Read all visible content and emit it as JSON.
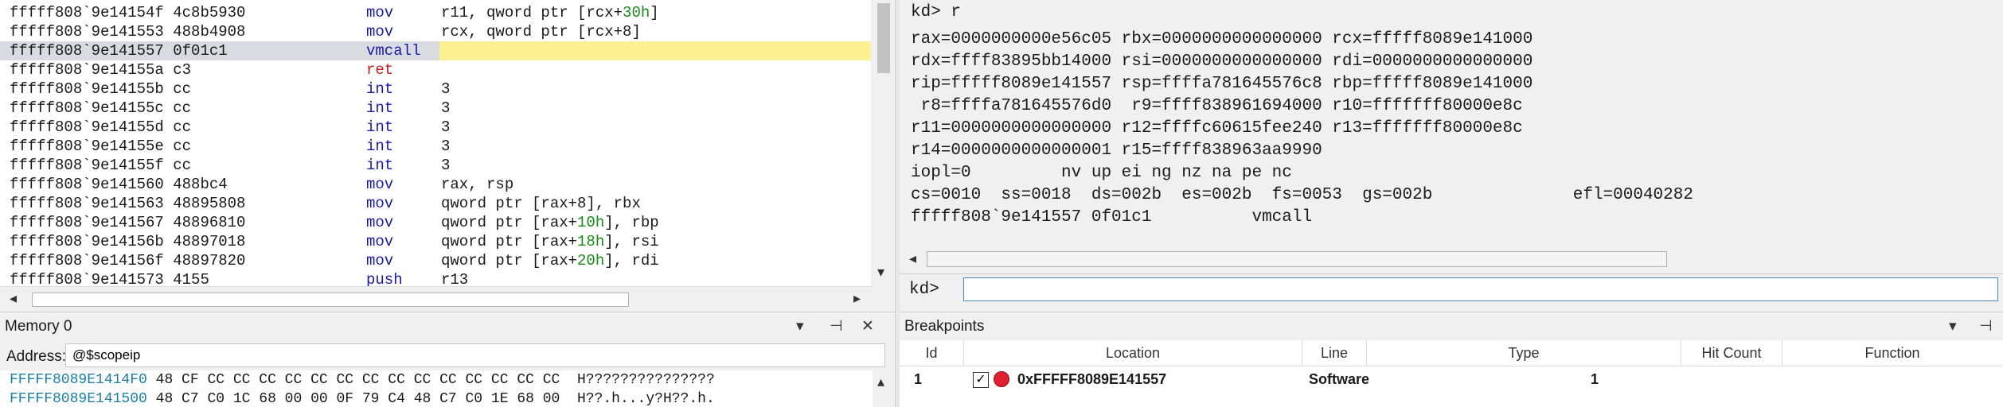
{
  "disassembly": {
    "lines": [
      {
        "addr": "fffff808`9e14154f 4c8b5930",
        "mnemonic": "mov",
        "operands_pre": "r11, qword ptr [rcx+",
        "operands_num": "30h",
        "operands_post": "]"
      },
      {
        "addr": "fffff808`9e141553 488b4908",
        "mnemonic": "mov",
        "operands_pre": "rcx, qword ptr [rcx+8]",
        "operands_num": "",
        "operands_post": ""
      },
      {
        "addr": "fffff808`9e141557 0f01c1",
        "mnemonic": "vmcall",
        "operands_pre": "",
        "operands_num": "",
        "operands_post": ""
      },
      {
        "addr": "fffff808`9e14155a c3",
        "mnemonic": "ret",
        "operands_pre": "",
        "operands_num": "",
        "operands_post": ""
      },
      {
        "addr": "fffff808`9e14155b cc",
        "mnemonic": "int",
        "operands_pre": "3",
        "operands_num": "",
        "operands_post": ""
      },
      {
        "addr": "fffff808`9e14155c cc",
        "mnemonic": "int",
        "operands_pre": "3",
        "operands_num": "",
        "operands_post": ""
      },
      {
        "addr": "fffff808`9e14155d cc",
        "mnemonic": "int",
        "operands_pre": "3",
        "operands_num": "",
        "operands_post": ""
      },
      {
        "addr": "fffff808`9e14155e cc",
        "mnemonic": "int",
        "operands_pre": "3",
        "operands_num": "",
        "operands_post": ""
      },
      {
        "addr": "fffff808`9e14155f cc",
        "mnemonic": "int",
        "operands_pre": "3",
        "operands_num": "",
        "operands_post": ""
      },
      {
        "addr": "fffff808`9e141560 488bc4",
        "mnemonic": "mov",
        "operands_pre": "rax, rsp",
        "operands_num": "",
        "operands_post": ""
      },
      {
        "addr": "fffff808`9e141563 48895808",
        "mnemonic": "mov",
        "operands_pre": "qword ptr [rax+8], rbx",
        "operands_num": "",
        "operands_post": ""
      },
      {
        "addr": "fffff808`9e141567 48896810",
        "mnemonic": "mov",
        "operands_pre": "qword ptr [rax+",
        "operands_num": "10h",
        "operands_post": "], rbp"
      },
      {
        "addr": "fffff808`9e14156b 48897018",
        "mnemonic": "mov",
        "operands_pre": "qword ptr [rax+",
        "operands_num": "18h",
        "operands_post": "], rsi"
      },
      {
        "addr": "fffff808`9e14156f 48897820",
        "mnemonic": "mov",
        "operands_pre": "qword ptr [rax+",
        "operands_num": "20h",
        "operands_post": "], rdi"
      },
      {
        "addr": "fffff808`9e141573 4155",
        "mnemonic": "push",
        "operands_pre": "r13",
        "operands_num": "",
        "operands_post": ""
      }
    ],
    "current_index": 2
  },
  "command": {
    "lines": [
      "kd> r",
      "rax=0000000000e56c05 rbx=0000000000000000 rcx=fffff8089e141000",
      "rdx=ffff83895bb14000 rsi=0000000000000000 rdi=0000000000000000",
      "rip=fffff8089e141557 rsp=ffffa781645576c8 rbp=fffff8089e141000",
      " r8=ffffa781645576d0  r9=ffff838961694000 r10=fffffff80000e8c",
      "r11=0000000000000000 r12=ffffc60615fee240 r13=fffffff80000e8c",
      "r14=0000000000000001 r15=ffff838963aa9990",
      "iopl=0         nv up ei ng nz na pe nc",
      "cs=0010  ss=0018  ds=002b  es=002b  fs=0053  gs=002b              efl=00040282",
      "fffff808`9e141557 0f01c1          vmcall"
    ],
    "prompt": "kd>",
    "input_value": ""
  },
  "memory": {
    "title": "Memory 0",
    "address_label": "Address:",
    "address_value": "@$scopeip",
    "lines": [
      {
        "addr": "FFFFF8089E1414F0",
        "bytes": "48 CF CC CC CC CC CC CC CC CC CC CC CC CC CC CC",
        "ascii": "H???????????????"
      },
      {
        "addr": "FFFFF8089E141500",
        "bytes": "48 C7 C0 1C 68 00 00 0F 79 C4 48 C7 C0 1E 68 00",
        "ascii": "H??.h...y?H??.h."
      }
    ]
  },
  "breakpoints": {
    "title": "Breakpoints",
    "columns": [
      "Id",
      "Location",
      "Line",
      "Type",
      "Hit Count",
      "Function"
    ],
    "rows": [
      {
        "id": "1",
        "enabled": true,
        "location": "0xFFFFF8089E141557",
        "line": "",
        "type": "Software",
        "hit_count": "1",
        "function": ""
      }
    ]
  },
  "icons": {
    "dropdown": "▾",
    "pin": "⊣",
    "close": "✕",
    "scroll_left": "◂",
    "scroll_right": "▸",
    "scroll_up": "▴",
    "scroll_down": "▾",
    "check": "✓"
  },
  "colors": {
    "current_line_bg": "#d8dbe0",
    "highlight_yellow": "#fdf092",
    "mnemonic_blue": "#1a1aa8",
    "ret_red": "#c02020",
    "number_green": "#1a8a1a",
    "mem_addr_teal": "#1a7fa0",
    "breakpoint_red": "#e02030"
  }
}
